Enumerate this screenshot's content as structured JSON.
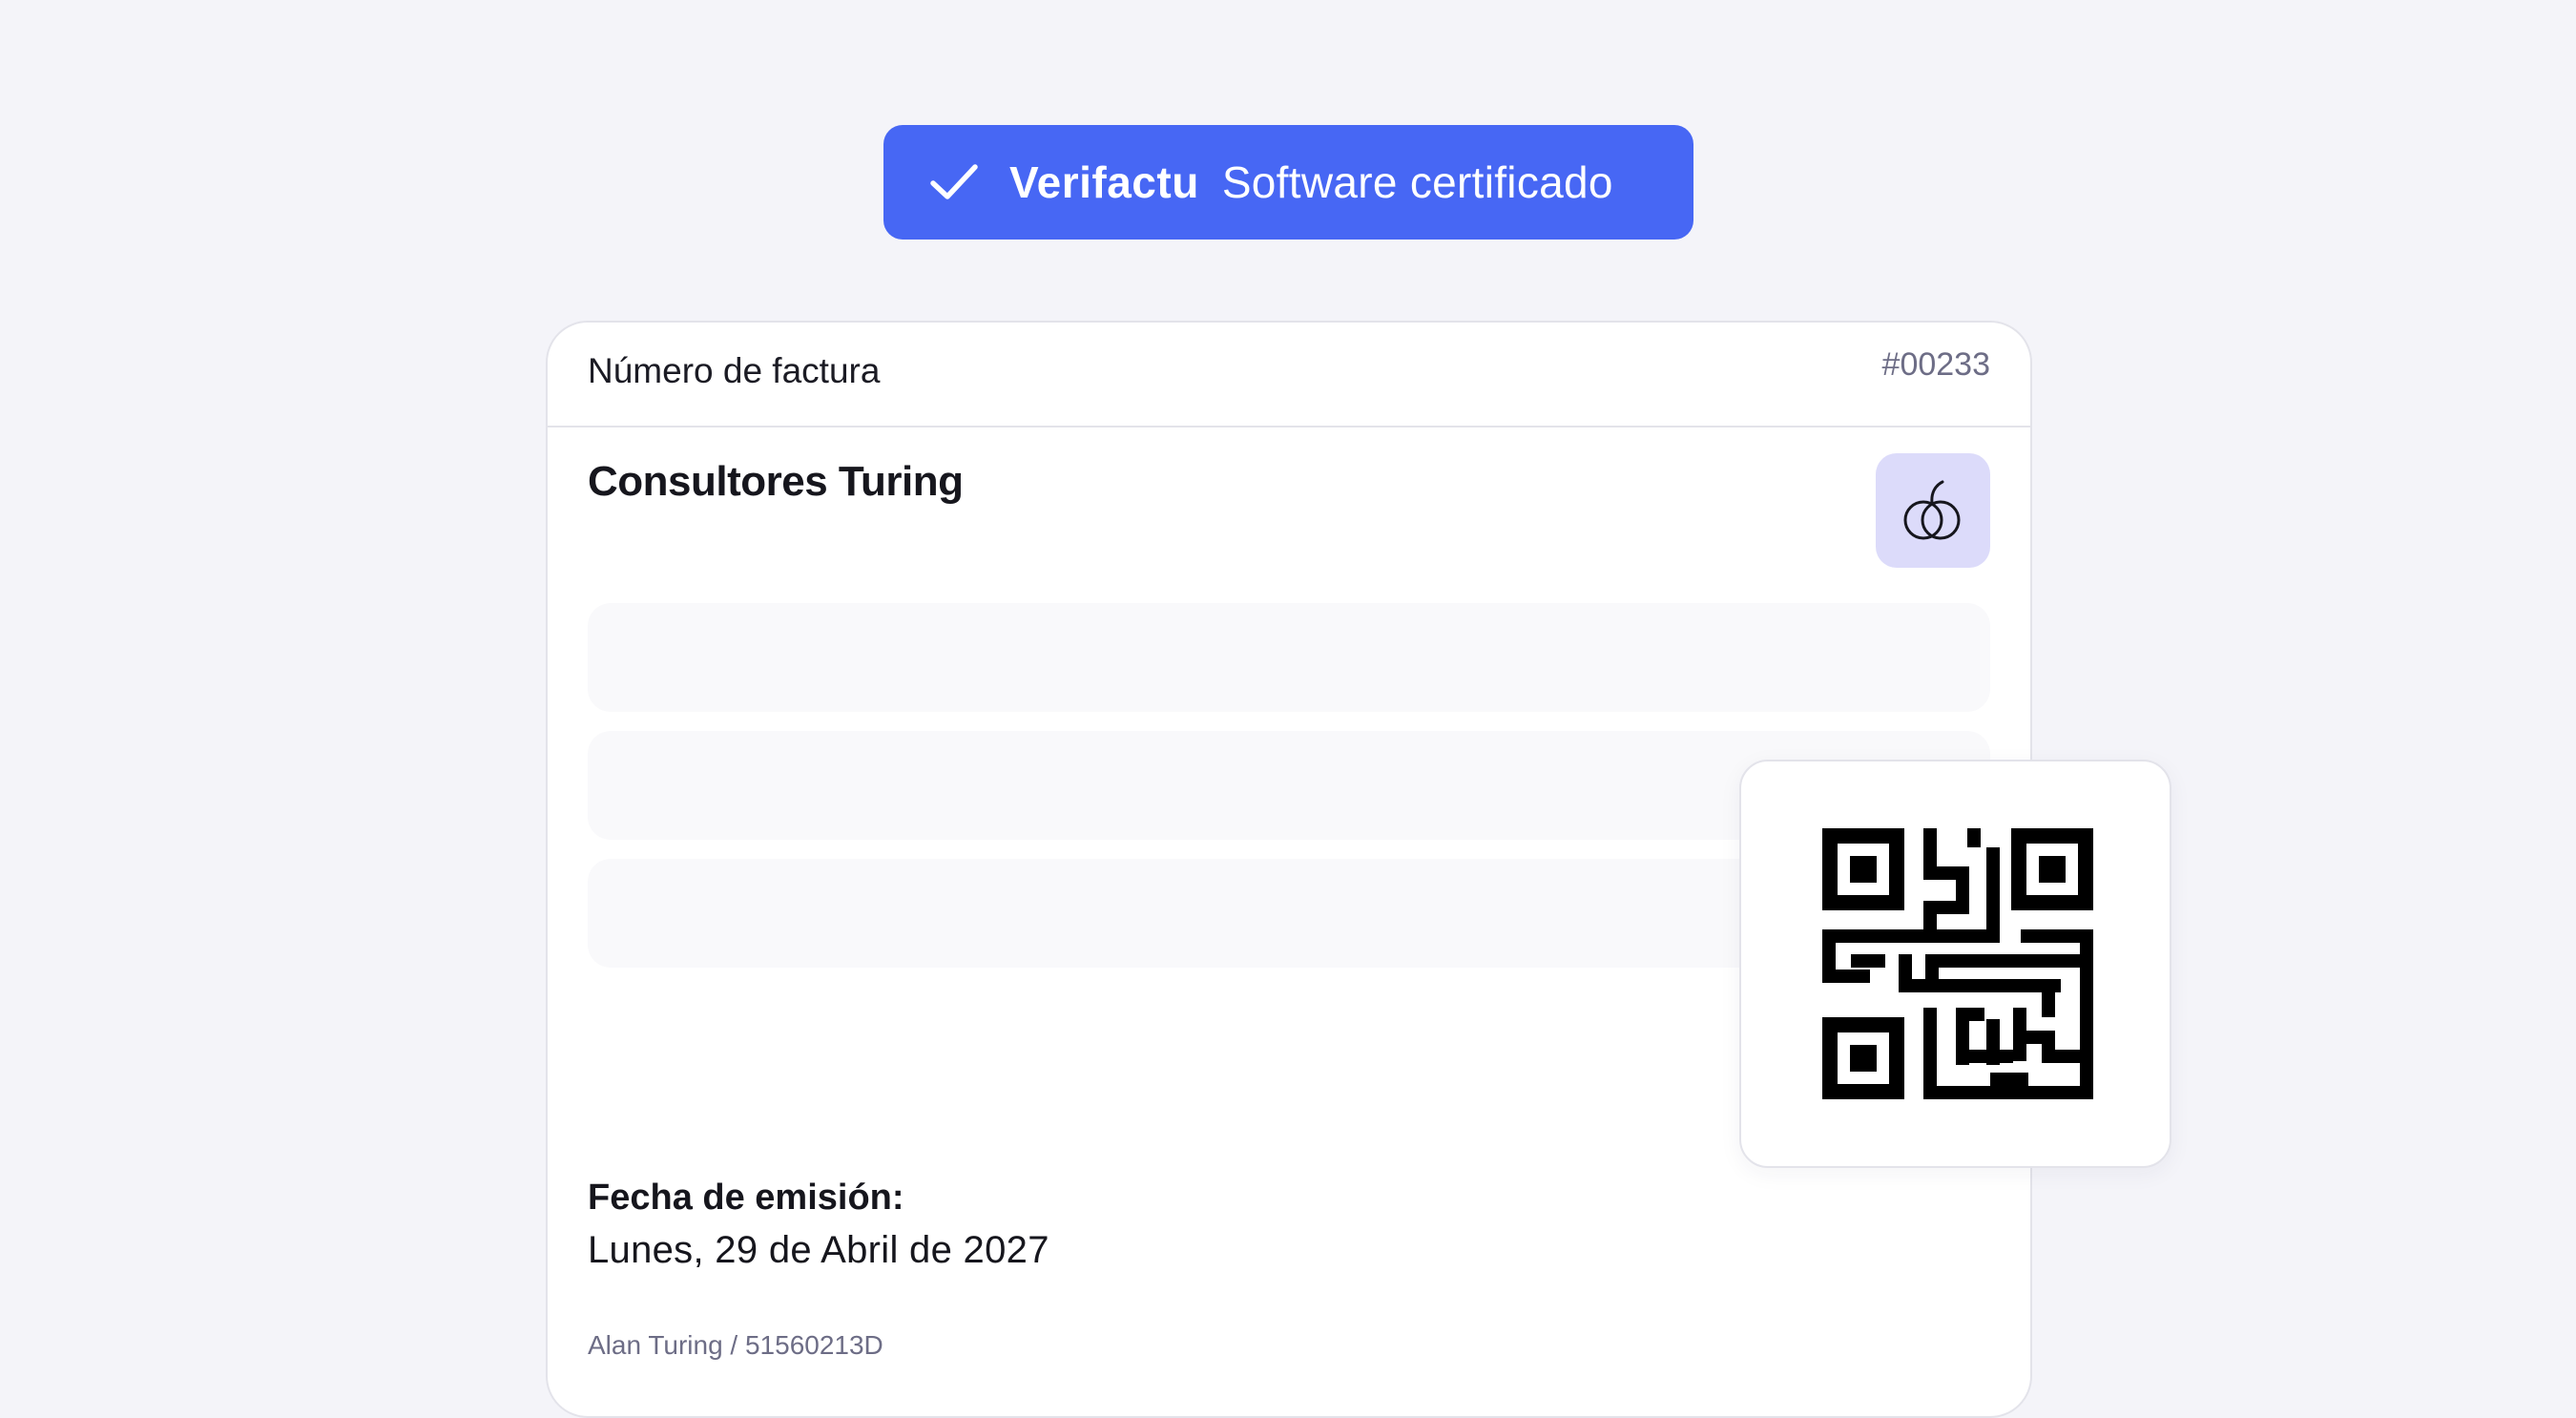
{
  "badge": {
    "brand": "Verifactu",
    "tagline": "Software certificado",
    "icon": "check-icon",
    "color": "#4767f4"
  },
  "invoice": {
    "number_label": "Número de factura",
    "number": "#00233",
    "company": "Consultores Turing",
    "logo_icon": "fruit-logo-icon",
    "date_label": "Fecha de emisión:",
    "date_value": "Lunes, 29 de Abril de 2027",
    "owner": "Alan Turing / 51560213D"
  },
  "qr": {
    "icon": "qr-code-icon"
  },
  "colors": {
    "background": "#f4f4f9",
    "accent": "#4767f4",
    "logo_tile": "#dcdbfa",
    "muted_text": "#6d6d86"
  }
}
